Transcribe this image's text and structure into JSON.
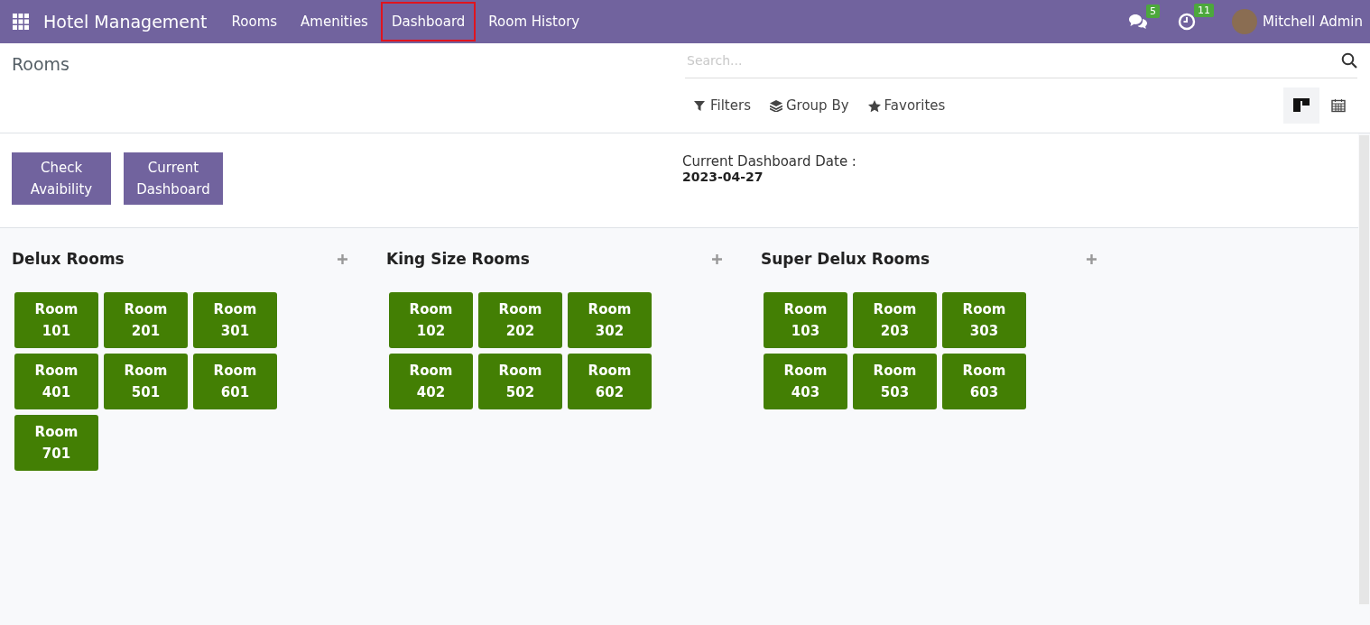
{
  "navbar": {
    "app_title": "Hotel Management",
    "menu": [
      {
        "label": "Rooms",
        "highlighted": false
      },
      {
        "label": "Amenities",
        "highlighted": false
      },
      {
        "label": "Dashboard",
        "highlighted": true
      },
      {
        "label": "Room History",
        "highlighted": false
      }
    ],
    "messages_badge": "5",
    "activities_badge": "11",
    "user": "Mitchell Admin"
  },
  "control_panel": {
    "breadcrumb": "Rooms",
    "search": {
      "placeholder": "Search..."
    },
    "search_options": [
      {
        "kind": "filter",
        "label": "Filters"
      },
      {
        "kind": "group",
        "label": "Group By"
      },
      {
        "kind": "favorite",
        "label": "Favorites"
      }
    ],
    "views": [
      {
        "kind": "kanban",
        "selected": true
      },
      {
        "kind": "calendar",
        "selected": false
      }
    ]
  },
  "actions": [
    "Check Avaibility",
    "Current Dashboard"
  ],
  "dashboard_date": {
    "label": "Current Dashboard Date :",
    "value": "2023-04-27"
  },
  "columns": [
    {
      "title": "Delux Rooms",
      "rooms": [
        "Room 101",
        "Room 201",
        "Room 301",
        "Room 401",
        "Room 501",
        "Room 601",
        "Room 701"
      ]
    },
    {
      "title": "King Size Rooms",
      "rooms": [
        "Room 102",
        "Room 202",
        "Room 302",
        "Room 402",
        "Room 502",
        "Room 602"
      ]
    },
    {
      "title": "Super Delux Rooms",
      "rooms": [
        "Room 103",
        "Room 203",
        "Room 303",
        "Room 403",
        "Room 503",
        "Room 603"
      ]
    }
  ]
}
